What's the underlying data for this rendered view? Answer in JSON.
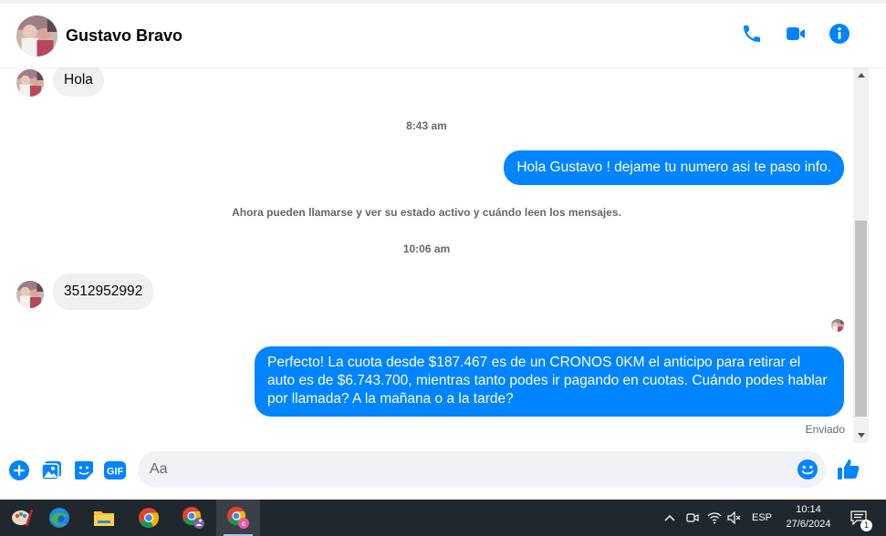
{
  "header": {
    "contact_name": "Gustavo Bravo",
    "actions": [
      "phone-icon",
      "video-camera-icon",
      "info-icon"
    ],
    "accent_color": "#0084ff"
  },
  "messages": {
    "incoming_1": "Hola",
    "time_1": "8:43 am",
    "outgoing_1": "Hola Gustavo ! dejame tu numero asi te paso info.",
    "system_notice": "Ahora pueden llamarse y ver su estado activo y cuándo leen los mensajes.",
    "time_2": "10:06 am",
    "incoming_2": "3512952992",
    "outgoing_2": "Perfecto! La cuota desde $187.467 es de un CRONOS 0KM el anticipo para retirar el auto es de $6.743.700, mientras tanto podes ir pagando en cuotas. Cuándo podes hablar por llamada? A la mañana o a la tarde?",
    "status": "Enviado"
  },
  "composer": {
    "placeholder": "Aa",
    "buttons": [
      "plus-circle-icon",
      "image-icon",
      "sticker-icon",
      "gif-icon"
    ],
    "gif_label": "GIF",
    "emoji": "emoji-icon",
    "like": "thumbs-up-icon"
  },
  "taskbar": {
    "apps": [
      "paint-icon",
      "edge-icon",
      "file-explorer-icon",
      "chrome-icon",
      "chrome-profile-icon",
      "chrome-profile-c-icon"
    ],
    "language": "ESP",
    "time": "10:14",
    "date": "27/6/2024",
    "notification_count": "1"
  }
}
